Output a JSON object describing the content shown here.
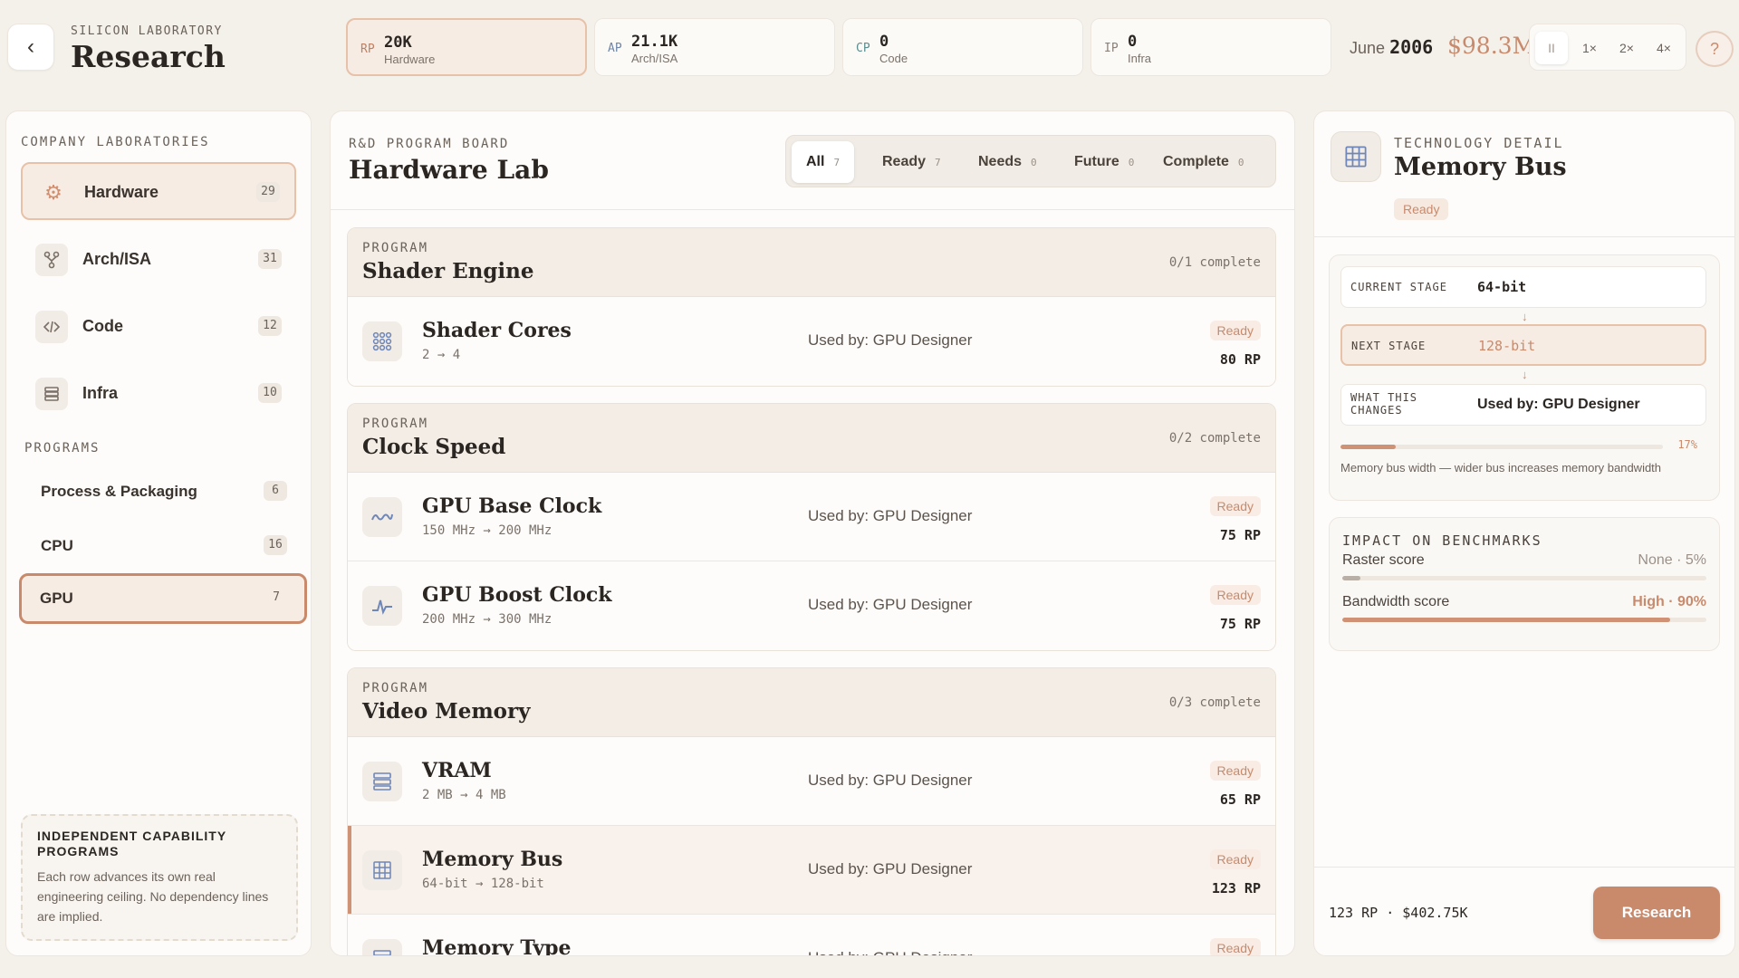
{
  "header": {
    "subtitle": "SILICON LABORATORY",
    "title": "Research",
    "points": [
      {
        "abbr": "RP",
        "value": "20K",
        "label": "Hardware"
      },
      {
        "abbr": "AP",
        "value": "21.1K",
        "label": "Arch/ISA"
      },
      {
        "abbr": "CP",
        "value": "0",
        "label": "Code"
      },
      {
        "abbr": "IP",
        "value": "0",
        "label": "Infra"
      }
    ],
    "date_month": "June",
    "date_year": "2006",
    "money": "$98.3M",
    "speeds": [
      "II",
      "1×",
      "2×",
      "4×"
    ],
    "help": "?"
  },
  "sidebar": {
    "labs_label": "COMPANY LABORATORIES",
    "labs": [
      {
        "name": "Hardware",
        "count": "29",
        "icon": "chip-icon"
      },
      {
        "name": "Arch/ISA",
        "count": "31",
        "icon": "tree-icon"
      },
      {
        "name": "Code",
        "count": "12",
        "icon": "code-icon"
      },
      {
        "name": "Infra",
        "count": "10",
        "icon": "server-icon"
      }
    ],
    "programs_label": "PROGRAMS",
    "programs": [
      {
        "name": "Process & Packaging",
        "count": "6"
      },
      {
        "name": "CPU",
        "count": "16"
      },
      {
        "name": "GPU",
        "count": "7"
      }
    ],
    "note_title": "INDEPENDENT CAPABILITY PROGRAMS",
    "note_text": "Each row advances its own real engineering ceiling. No dependency lines are implied."
  },
  "board": {
    "subtitle": "R&D PROGRAM BOARD",
    "title": "Hardware Lab",
    "filters": [
      {
        "label": "All",
        "count": "7"
      },
      {
        "label": "Ready",
        "count": "7"
      },
      {
        "label": "Needs",
        "count": "0"
      },
      {
        "label": "Future",
        "count": "0"
      },
      {
        "label": "Complete",
        "count": "0"
      }
    ],
    "program_label": "PROGRAM",
    "groups": [
      {
        "title": "Shader Engine",
        "count": "0/1 complete",
        "rows": [
          {
            "name": "Shader Cores",
            "range": "2 → 4",
            "used": "Used by: GPU Designer",
            "status": "Ready",
            "cost": "80 RP"
          }
        ]
      },
      {
        "title": "Clock Speed",
        "count": "0/2 complete",
        "rows": [
          {
            "name": "GPU Base Clock",
            "range": "150 MHz → 200 MHz",
            "used": "Used by: GPU Designer",
            "status": "Ready",
            "cost": "75 RP"
          },
          {
            "name": "GPU Boost Clock",
            "range": "200 MHz → 300 MHz",
            "used": "Used by: GPU Designer",
            "status": "Ready",
            "cost": "75 RP"
          }
        ]
      },
      {
        "title": "Video Memory",
        "count": "0/3 complete",
        "rows": [
          {
            "name": "VRAM",
            "range": "2 MB → 4 MB",
            "used": "Used by: GPU Designer",
            "status": "Ready",
            "cost": "65 RP"
          },
          {
            "name": "Memory Bus",
            "range": "64-bit → 128-bit",
            "used": "Used by: GPU Designer",
            "status": "Ready",
            "cost": "123 RP"
          },
          {
            "name": "Memory Type",
            "range": "",
            "used": "Used by: GPU Designer",
            "status": "Ready",
            "cost": ""
          }
        ]
      }
    ]
  },
  "detail": {
    "subtitle": "TECHNOLOGY DETAIL",
    "title": "Memory Bus",
    "status": "Ready",
    "current_stage_label": "CURRENT STAGE",
    "current_stage": "64-bit",
    "next_stage_label": "NEXT STAGE",
    "next_stage": "128-bit",
    "changes_label_1": "WHAT THIS",
    "changes_label_2": "CHANGES",
    "changes": "Used by: GPU Designer",
    "progress_pct": "17%",
    "progress": 0.17,
    "description": "Memory bus width — wider bus increases memory bandwidth",
    "impact_label": "IMPACT ON BENCHMARKS",
    "impacts": [
      {
        "name": "Raster score",
        "value": "None · 5%",
        "fraction": 0.05
      },
      {
        "name": "Bandwidth score",
        "value": "High · 90%",
        "fraction": 0.9
      }
    ],
    "footer_cost": "123 RP · $402.75K",
    "research_label": "Research"
  }
}
